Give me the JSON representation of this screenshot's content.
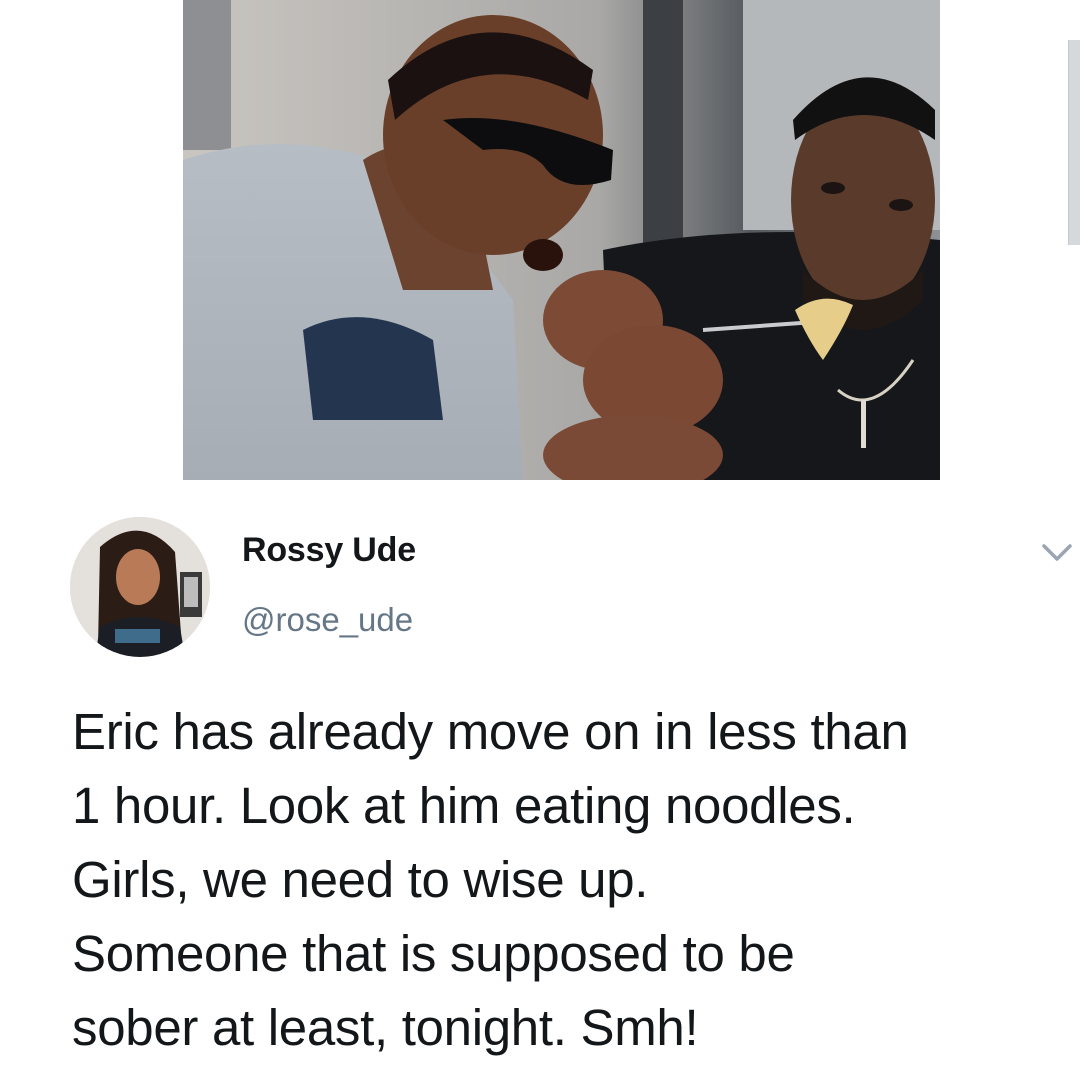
{
  "media": {
    "icon": "photo-of-two-men-eating-noodles"
  },
  "tweet": {
    "author": {
      "display_name": "Rossy Ude",
      "handle": "@rose_ude",
      "avatar_icon": "profile-photo-avatar"
    },
    "menu_icon": "chevron-down-icon",
    "text_lines": [
      "Eric has already move on in less than",
      "1 hour. Look at him eating noodles.",
      "Girls, we need to wise up.",
      "Someone that is supposed to be",
      "sober at least, tonight. Smh!"
    ]
  },
  "colors": {
    "text_primary": "#14171a",
    "text_secondary": "#657786",
    "background": "#ffffff"
  }
}
